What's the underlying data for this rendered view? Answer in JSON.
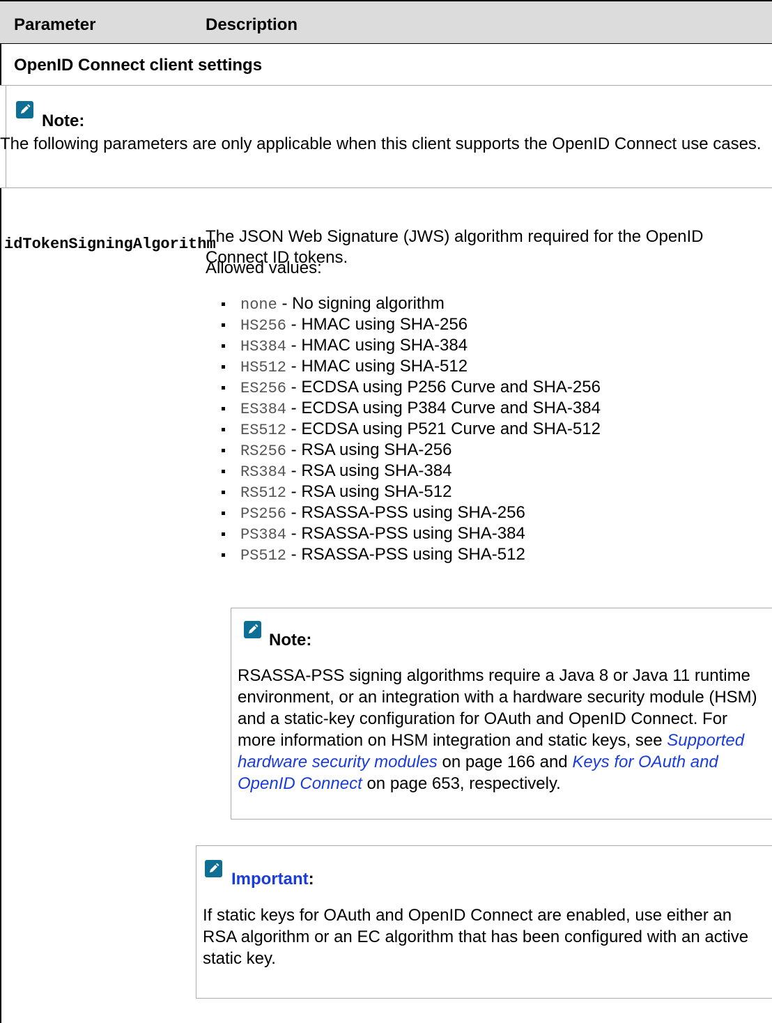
{
  "table": {
    "header": {
      "parameter": "Parameter",
      "description": "Description"
    },
    "section_title": "OpenID Connect client settings",
    "section_note": {
      "label": "Note:",
      "text": "The following parameters are only applicable when this client supports the OpenID Connect use cases."
    },
    "row": {
      "parameter": "idTokenSigningAlgorithm",
      "description": "The JSON Web Signature (JWS) algorithm required for the OpenID Connect ID tokens.",
      "allowed_label": "Allowed values:",
      "values": [
        {
          "code": "none",
          "text": " - No signing algorithm"
        },
        {
          "code": "HS256",
          "text": " - HMAC using SHA-256"
        },
        {
          "code": "HS384",
          "text": " - HMAC using SHA-384"
        },
        {
          "code": "HS512",
          "text": " - HMAC using SHA-512"
        },
        {
          "code": "ES256",
          "text": " - ECDSA using P256 Curve and SHA-256"
        },
        {
          "code": "ES384",
          "text": " - ECDSA using P384 Curve and SHA-384"
        },
        {
          "code": "ES512",
          "text": " - ECDSA using P521 Curve and SHA-512"
        },
        {
          "code": "RS256",
          "text": " - RSA using SHA-256"
        },
        {
          "code": "RS384",
          "text": " - RSA using SHA-384"
        },
        {
          "code": "RS512",
          "text": " - RSA using SHA-512"
        },
        {
          "code": "PS256",
          "text": " - RSASSA-PSS using SHA-256"
        },
        {
          "code": "PS384",
          "text": " - RSASSA-PSS using SHA-384"
        },
        {
          "code": "PS512",
          "text": " - RSASSA-PSS using SHA-512"
        }
      ],
      "note": {
        "label": "Note:",
        "text_1": "RSASSA-PSS signing algorithms require a Java 8 or Java 11 runtime environment, or an integration with a hardware security module (HSM) and a static-key configuration for OAuth and OpenID Connect. For more information on HSM integration and static keys, see ",
        "link_1": "Supported hardware security modules",
        "text_2": " on page 166 and ",
        "link_2": "Keys for OAuth and OpenID Connect",
        "text_3": " on page 653, respectively."
      },
      "important": {
        "label": "Important",
        "colon": ":",
        "text": "If static keys for OAuth and OpenID Connect are enabled, use either an RSA algorithm or an EC algorithm that has been configured with an active static key."
      }
    }
  },
  "colors": {
    "note_icon": "#0e6f95",
    "link": "#1a3cdb",
    "header_bg": "#dcdcdc"
  }
}
